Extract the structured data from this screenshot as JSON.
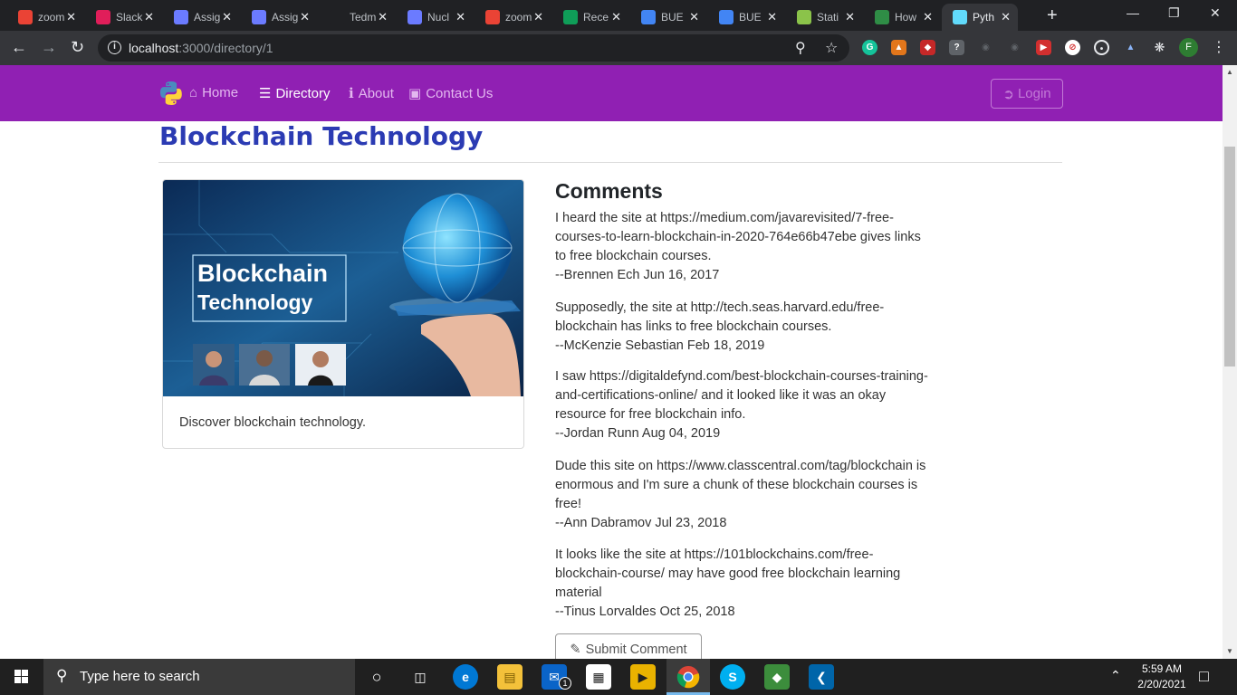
{
  "browser": {
    "tabs": [
      {
        "title": "zoom",
        "favicon": "gmail-icon",
        "color": "#ea4335"
      },
      {
        "title": "Slack",
        "favicon": "slack-icon",
        "color": "#e01e5a"
      },
      {
        "title": "Assign",
        "favicon": "react-app-icon",
        "color": "#6b7bff"
      },
      {
        "title": "Assign",
        "favicon": "react-app-icon",
        "color": "#6b7bff"
      },
      {
        "title": "Tedm",
        "favicon": "github-icon",
        "color": "#202124"
      },
      {
        "title": "Nucl",
        "favicon": "react-app-icon",
        "color": "#6b7bff"
      },
      {
        "title": "zoom",
        "favicon": "gmail-icon",
        "color": "#ea4335"
      },
      {
        "title": "Rece",
        "favicon": "google-drive-icon",
        "color": "#0f9d58"
      },
      {
        "title": "BUE",
        "favicon": "google-docs-icon",
        "color": "#4285f4"
      },
      {
        "title": "BUE",
        "favicon": "google-docs-icon",
        "color": "#4285f4"
      },
      {
        "title": "Stati",
        "favicon": "node-icon",
        "color": "#8bc34a"
      },
      {
        "title": "How",
        "favicon": "geeks-icon",
        "color": "#2f8d46"
      },
      {
        "title": "Pyth",
        "favicon": "react-icon",
        "color": "#61dafb",
        "active": true
      }
    ],
    "url_host": "localhost",
    "url_path": ":3000/directory/1",
    "profile_initial": "F"
  },
  "navbar": {
    "background": "#9020b3",
    "home": "Home",
    "directory": "Directory",
    "about": "About",
    "contact": "Contact Us",
    "login": "Login"
  },
  "page": {
    "title": "Blockchain Technology",
    "card_image_heading_1": "Blockchain",
    "card_image_heading_2": "Technology",
    "card_text": "Discover blockchain technology.",
    "comments_title": "Comments",
    "comments": [
      {
        "text": "I heard the site at https://medium.com/javarevisited/7-free-courses-to-learn-blockchain-in-2020-764e66b47ebe gives links to free blockchain courses.",
        "byline": "--Brennen Ech Jun 16, 2017"
      },
      {
        "text": "Supposedly, the site at http://tech.seas.harvard.edu/free-blockchain has links to free blockchain courses.",
        "byline": "--McKenzie Sebastian Feb 18, 2019"
      },
      {
        "text": "I saw https://digitaldefynd.com/best-blockchain-courses-training-and-certifications-online/ and it looked like it was an okay resource for free blockchain info.",
        "byline": "--Jordan Runn Aug 04, 2019"
      },
      {
        "text": "Dude this site on https://www.classcentral.com/tag/blockchain is enormous and I'm sure a chunk of these blockchain courses is free!",
        "byline": "--Ann Dabramov Jul 23, 2018"
      },
      {
        "text": "It looks like the site at https://101blockchains.com/free-blockchain-course/ may have good free blockchain learning material",
        "byline": "--Tinus Lorvaldes Oct 25, 2018"
      }
    ],
    "submit_label": "Submit Comment"
  },
  "taskbar": {
    "search_placeholder": "Type here to search",
    "time": "5:59 AM",
    "date": "2/20/2021",
    "mail_badge": "1"
  }
}
